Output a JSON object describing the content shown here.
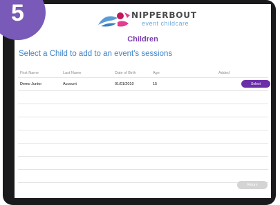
{
  "step": {
    "number": "5"
  },
  "logo": {
    "name": "NIPPERBOUT",
    "tagline": "event childcare"
  },
  "page": {
    "title": "Children",
    "subtitle": "Select a Child to add to an event's sessions"
  },
  "table": {
    "headers": [
      "First Name",
      "Last Name",
      "Date of Birth",
      "Age",
      "Added"
    ],
    "rows": [
      {
        "first_name": "Demo Junior",
        "last_name": "Account",
        "dob": "01/01/2010",
        "age": "15",
        "added": "",
        "action": "Select"
      }
    ]
  },
  "footer": {
    "return_label": "Return"
  },
  "pager": {
    "dots": "•••",
    "active": "•",
    "after": "••••"
  },
  "colors": {
    "accent": "#6b2fa8",
    "title": "#7a3fb0",
    "subtitle": "#3f85c8",
    "badge": "#7a5ab8"
  }
}
